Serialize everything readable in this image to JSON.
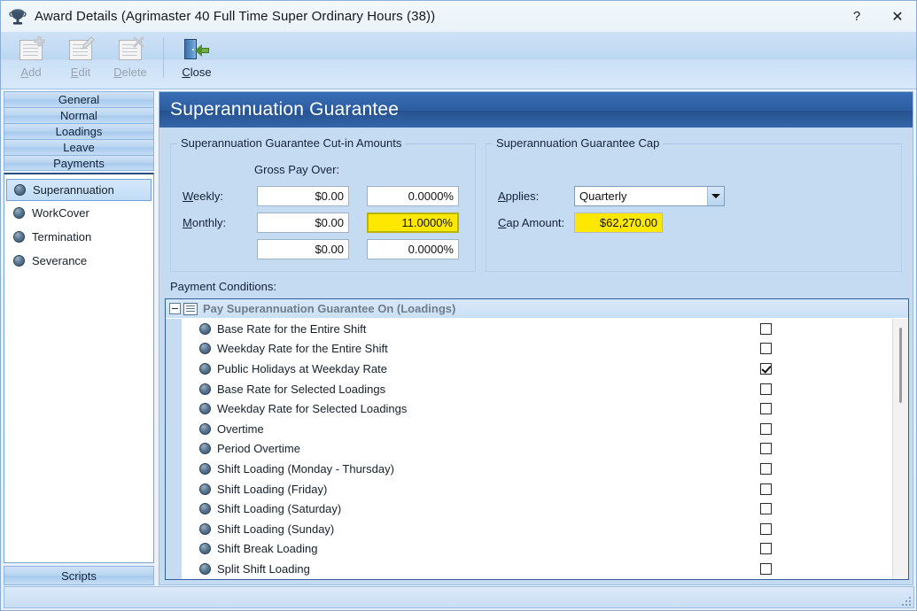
{
  "window": {
    "title": "Award Details (Agrimaster 40 Full Time Super Ordinary Hours (38))",
    "help_label": "?",
    "close_label": "✕",
    "icon": "award-trophy-icon"
  },
  "toolbar": {
    "items": [
      {
        "label_pre": "",
        "label_key": "A",
        "label_post": "dd",
        "name": "add-button",
        "enabled": false,
        "icon": "document-add-icon"
      },
      {
        "label_pre": "",
        "label_key": "E",
        "label_post": "dit",
        "name": "edit-button",
        "enabled": false,
        "icon": "document-edit-icon"
      },
      {
        "label_pre": "",
        "label_key": "D",
        "label_post": "elete",
        "name": "delete-button",
        "enabled": false,
        "icon": "document-delete-icon"
      },
      {
        "label_pre": "",
        "label_key": "C",
        "label_post": "lose",
        "name": "close-button",
        "enabled": true,
        "icon": "door-exit-icon"
      }
    ]
  },
  "sidebar": {
    "tabs": [
      {
        "label": "General",
        "name": "sidebar-tab-general"
      },
      {
        "label": "Normal",
        "name": "sidebar-tab-normal"
      },
      {
        "label": "Loadings",
        "name": "sidebar-tab-loadings"
      },
      {
        "label": "Leave",
        "name": "sidebar-tab-leave"
      },
      {
        "label": "Payments",
        "name": "sidebar-tab-payments"
      }
    ],
    "items": [
      {
        "label": "Superannuation",
        "selected": true
      },
      {
        "label": "WorkCover",
        "selected": false
      },
      {
        "label": "Termination",
        "selected": false
      },
      {
        "label": "Severance",
        "selected": false
      }
    ],
    "scripts_label": "Scripts"
  },
  "panel": {
    "header": "Superannuation Guarantee",
    "cutin": {
      "legend": "Superannuation Guarantee Cut-in Amounts",
      "column_header": "Gross Pay Over:",
      "rows": [
        {
          "label_key": "W",
          "label_rest": "eekly:",
          "amount": "$0.00",
          "percent": "0.0000%",
          "percent_highlight": false
        },
        {
          "label_key": "M",
          "label_rest": "onthly:",
          "amount": "$0.00",
          "percent": "11.0000%",
          "percent_highlight": true
        },
        {
          "label_key": "",
          "label_rest": "",
          "amount": "$0.00",
          "percent": "0.0000%",
          "percent_highlight": false
        }
      ]
    },
    "cap": {
      "legend": "Superannuation Guarantee Cap",
      "applies_label_key": "A",
      "applies_label_rest": "pplies:",
      "applies_value": "Quarterly",
      "cap_label_key": "C",
      "cap_label_rest": "ap Amount:",
      "cap_value": "$62,270.00"
    },
    "payment_conditions_label": "Payment Conditions:",
    "tree": {
      "header": "Pay Superannuation Guarantee On (Loadings)",
      "expanded": true,
      "rows": [
        {
          "label": "Base Rate for the Entire Shift",
          "checked": false
        },
        {
          "label": "Weekday Rate for the Entire Shift",
          "checked": false
        },
        {
          "label": "Public Holidays at Weekday Rate",
          "checked": true
        },
        {
          "label": "Base Rate for Selected Loadings",
          "checked": false
        },
        {
          "label": "Weekday Rate for Selected Loadings",
          "checked": false
        },
        {
          "label": "Overtime",
          "checked": false
        },
        {
          "label": "Period Overtime",
          "checked": false
        },
        {
          "label": "Shift Loading (Monday - Thursday)",
          "checked": false
        },
        {
          "label": "Shift Loading (Friday)",
          "checked": false
        },
        {
          "label": "Shift Loading (Saturday)",
          "checked": false
        },
        {
          "label": "Shift Loading (Sunday)",
          "checked": false
        },
        {
          "label": "Shift Break Loading",
          "checked": false
        },
        {
          "label": "Split Shift Loading",
          "checked": false
        }
      ]
    }
  },
  "colors": {
    "header_blue": "#2d5ca0",
    "panel_bg": "#c5dbf2",
    "highlight_yellow": "#ffe800",
    "highlight_border": "#b5b500",
    "tree_border": "#2f5f9e"
  }
}
